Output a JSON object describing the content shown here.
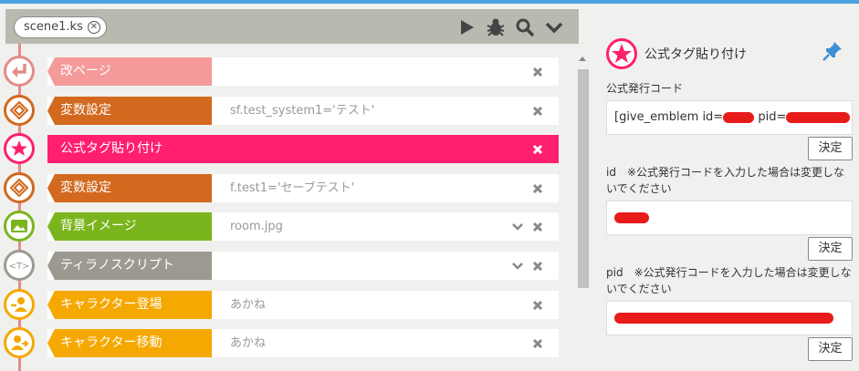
{
  "tab": {
    "label": "scene1.ks",
    "close_icon": "close-circle-icon"
  },
  "toolbar": {
    "icons": [
      "play-icon",
      "bug-icon",
      "search-icon",
      "chevron-down-icon"
    ]
  },
  "rows": [
    {
      "label": "改ページ",
      "value": "",
      "color": "#f59a9a",
      "circle_color": "#e58a8a",
      "icon": "return-icon",
      "chevron": false,
      "active": false
    },
    {
      "label": "変数設定",
      "value": "sf.test_system1='テスト'",
      "color": "#d2691e",
      "circle_color": "#d2691e",
      "icon": "cube-icon",
      "chevron": false,
      "active": false
    },
    {
      "label": "公式タグ貼り付け",
      "value": "",
      "color": "#ff1f6e",
      "circle_color": "#ff1f6e",
      "icon": "star-icon",
      "chevron": false,
      "active": true
    },
    {
      "label": "変数設定",
      "value": "f.test1='セーブテスト'",
      "color": "#d2691e",
      "circle_color": "#d2691e",
      "icon": "cube-icon",
      "chevron": false,
      "active": false
    },
    {
      "label": "背景イメージ",
      "value": "room.jpg",
      "color": "#7ab51d",
      "circle_color": "#7ab51d",
      "icon": "image-icon",
      "chevron": true,
      "active": false
    },
    {
      "label": "ティラノスクリプト",
      "value": "",
      "color": "#9c9a90",
      "circle_color": "#9c9a90",
      "icon": "script-tag-icon",
      "chevron": true,
      "active": false
    },
    {
      "label": "キャラクター登場",
      "value": "あかね",
      "color": "#f5a800",
      "circle_color": "#f5a800",
      "icon": "character-enter-icon",
      "chevron": false,
      "active": false
    },
    {
      "label": "キャラクター移動",
      "value": "あかね",
      "color": "#f5a800",
      "circle_color": "#f5a800",
      "icon": "character-move-icon",
      "chevron": false,
      "active": false
    }
  ],
  "panel": {
    "title": "公式タグ貼り付け",
    "pin_icon": "pin-icon",
    "field1_label": "公式発行コード",
    "field1_value_prefix": "[give_emblem id=",
    "field1_value_mid": " pid=",
    "submit_label": "決定",
    "field2_label": "id　※公式発行コードを入力した場合は変更しないでください",
    "field3_label": "pid　※公式発行コードを入力した場合は変更しないでください"
  }
}
